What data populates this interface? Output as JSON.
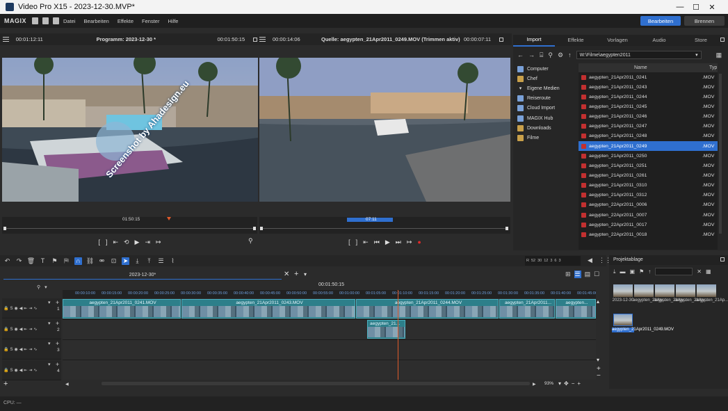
{
  "window": {
    "title": "Video Pro X15 - 2023-12-30.MVP*",
    "minimize": "—",
    "maximize": "☐",
    "close": "✕"
  },
  "menubar": {
    "logo": "MAGIX",
    "items": [
      "Datei",
      "Bearbeiten",
      "Effekte",
      "Fenster",
      "Hilfe"
    ],
    "edit_button": "Bearbeiten",
    "burn_button": "Brennen"
  },
  "program_monitor": {
    "left_time": "00:01:12:11",
    "title": "Programm: 2023-12-30 *",
    "right_time": "00:01:50:15",
    "scrub_time": "01:50:15"
  },
  "source_monitor": {
    "left_time": "00:00:14:06",
    "title": "Quelle: aegypten_21Apr2011_0249.MOV (Trimmen aktiv)",
    "right_time": "00:00:07:11",
    "scrub_time": "07:11"
  },
  "watermark": "Screenshot by Ahadesign.eu",
  "media_pool": {
    "tabs": [
      "Import",
      "Effekte",
      "Vorlagen",
      "Audio",
      "Store"
    ],
    "active_tab": "Import",
    "path": "W:\\Filme\\aegypten2011",
    "tree": [
      {
        "label": "Computer",
        "icon": "computer-icon"
      },
      {
        "label": "Chef",
        "icon": "folder-icon"
      },
      {
        "label": "Eigene Medien",
        "icon": "chevron-down-icon"
      },
      {
        "label": "Reiseroute",
        "icon": "route-icon"
      },
      {
        "label": "Cloud Import",
        "icon": "cloud-icon"
      },
      {
        "label": "MAGIX Hub",
        "icon": "hub-icon"
      },
      {
        "label": "Downloads",
        "icon": "folder-icon"
      },
      {
        "label": "Filme",
        "icon": "folder-icon"
      }
    ],
    "columns": [
      "Name",
      "Typ"
    ],
    "files": [
      {
        "name": "aegypten_21Apr2011_0241",
        "type": ".MOV"
      },
      {
        "name": "aegypten_21Apr2011_0243",
        "type": ".MOV"
      },
      {
        "name": "aegypten_21Apr2011_0244",
        "type": ".MOV"
      },
      {
        "name": "aegypten_21Apr2011_0245",
        "type": ".MOV"
      },
      {
        "name": "aegypten_21Apr2011_0246",
        "type": ".MOV"
      },
      {
        "name": "aegypten_21Apr2011_0247",
        "type": ".MOV"
      },
      {
        "name": "aegypten_21Apr2011_0248",
        "type": ".MOV"
      },
      {
        "name": "aegypten_21Apr2011_0249",
        "type": ".MOV"
      },
      {
        "name": "aegypten_21Apr2011_0250",
        "type": ".MOV"
      },
      {
        "name": "aegypten_21Apr2011_0251",
        "type": ".MOV"
      },
      {
        "name": "aegypten_21Apr2011_0261",
        "type": ".MOV"
      },
      {
        "name": "aegypten_21Apr2011_0310",
        "type": ".MOV"
      },
      {
        "name": "aegypten_21Apr2011_0312",
        "type": ".MOV"
      },
      {
        "name": "aegypten_22Apr2011_0006",
        "type": ".MOV"
      },
      {
        "name": "aegypten_22Apr2011_0007",
        "type": ".MOV"
      },
      {
        "name": "aegypten_22Apr2011_0017",
        "type": ".MOV"
      },
      {
        "name": "aegypten_22Apr2011_0018",
        "type": ".MOV"
      }
    ],
    "selected_index": 7
  },
  "timeline": {
    "tab_label": "2023-12-30*",
    "position": "00:01:50:15",
    "ruler": [
      "00:00:10:00",
      "00:00:15:00",
      "00:00:20:00",
      "00:00:25:00",
      "00:00:30:00",
      "00:00:35:00",
      "00:00:40:00",
      "00:00:45:00",
      "00:00:50:00",
      "00:00:55:00",
      "00:01:00:00",
      "00:01:05:00",
      "00:01:10:00",
      "00:01:15:00",
      "00:01:20:00",
      "00:01:25:00",
      "00:01:30:00",
      "00:01:35:00",
      "00:01:40:00",
      "00:01:45:00"
    ],
    "meter_labels": [
      "R",
      "L",
      "52",
      "30",
      "12",
      "3",
      "6",
      "3",
      "6"
    ],
    "tracks": [
      "1",
      "2",
      "3",
      "4"
    ],
    "track1_clips": [
      "aegypten_21Apr2011_0241.MOV",
      "aegypten_21Apr2011_0243.MOV",
      "aegypten_21Apr2011_0244.MOV",
      "aegypten_21Apr2011...",
      "aegypten..."
    ],
    "track2_clip": "aegypten_21...",
    "zoom": "93%"
  },
  "project_bin": {
    "title": "Projektablage",
    "items": [
      {
        "label": "2023-12-30"
      },
      {
        "label": "aegypten_21Ap..."
      },
      {
        "label": "aegypten_21Ap..."
      },
      {
        "label": "aegypten_21Ap..."
      },
      {
        "label": "aegypten_21Ap..."
      },
      {
        "label": "aegypten_21Apr2011_0249.MOV"
      }
    ]
  },
  "status": {
    "cpu": "CPU: —"
  }
}
